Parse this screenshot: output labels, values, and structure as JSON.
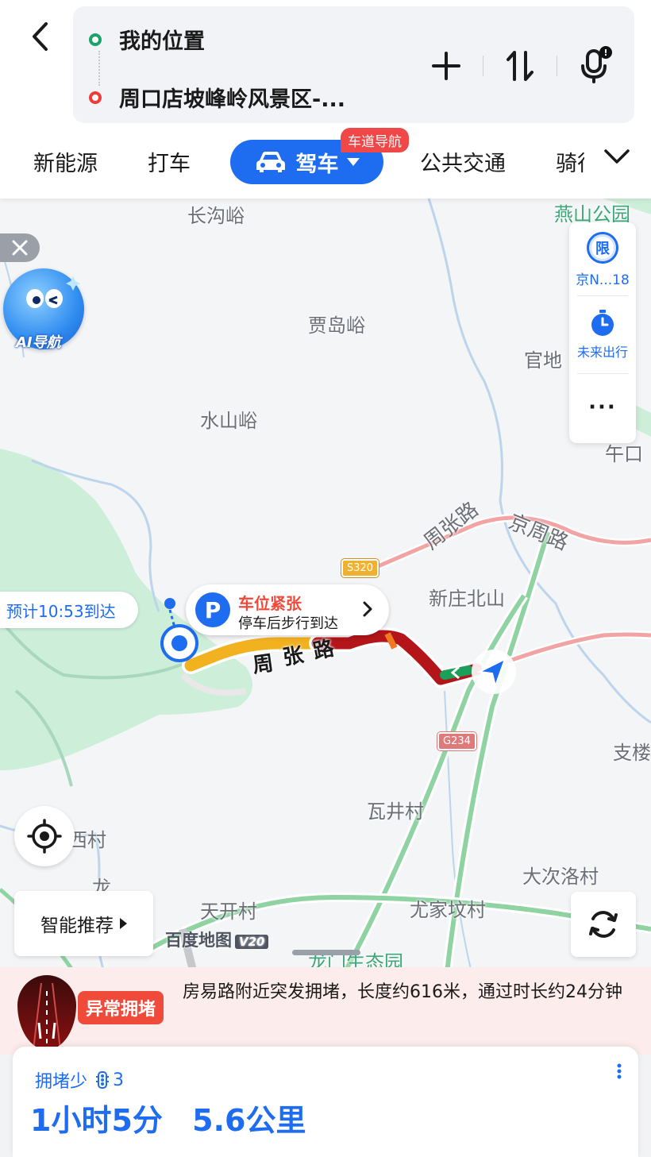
{
  "header": {
    "origin": "我的位置",
    "destination": "周口店坡峰岭风景区-...",
    "origin_color": "#1aa36b",
    "destination_color": "#ef3b3b"
  },
  "modes": {
    "items": [
      "新能源",
      "打车"
    ],
    "active": "驾车",
    "active_badge": "车道导航",
    "after": [
      "公共交通",
      "骑行"
    ],
    "accent": "#1e6cf0"
  },
  "map": {
    "places": [
      "长沟峪",
      "燕山公园",
      "贾岛峪",
      "官地",
      "水山峪",
      "午口",
      "新庄北山",
      "支楼",
      "瓦井村",
      "大次洛村",
      "西村",
      "天开村",
      "尤家坟村",
      "龙门生态园",
      "龙"
    ],
    "roads": [
      "周张路",
      "京周路"
    ],
    "shields": [
      "S320",
      "G234"
    ],
    "route_label_chars": [
      "周",
      "张",
      "路"
    ]
  },
  "side_panel": {
    "restriction_icon": "限",
    "restriction_label": "京N...18",
    "future_label": "未来出行",
    "more": "···"
  },
  "ai": {
    "label": "AI导航"
  },
  "eta": {
    "text": "预计10:53到达"
  },
  "parking": {
    "icon": "P",
    "title": "车位紧张",
    "subtitle": "停车后步行到达"
  },
  "controls": {
    "smart": "智能推荐"
  },
  "brand": {
    "name": "百度地图",
    "version": "V20"
  },
  "alert": {
    "tag": "异常拥堵",
    "text": "房易路附近突发拥堵，长度约616米，通过时长约24分钟"
  },
  "route_summary": {
    "congestion_label": "拥堵少",
    "lights_count": "3",
    "duration": "1小时5分",
    "distance": "5.6公里"
  }
}
